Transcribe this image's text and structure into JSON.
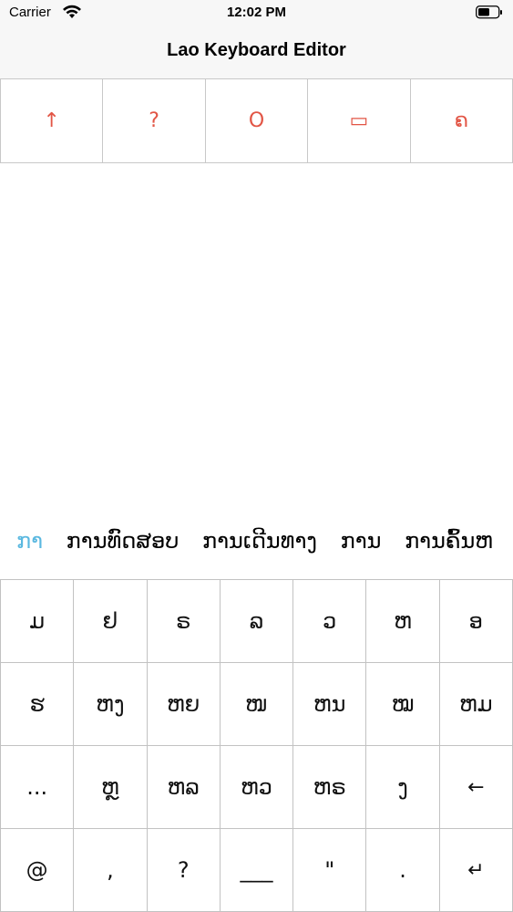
{
  "status": {
    "carrier": "Carrier",
    "time": "12:02 PM"
  },
  "nav": {
    "title": "Lao Keyboard Editor"
  },
  "toolbar": {
    "items": [
      {
        "label": "↑",
        "icon": "up-arrow-icon"
      },
      {
        "label": "?",
        "icon": "question-icon"
      },
      {
        "label": "O",
        "icon": "circle-o-icon"
      },
      {
        "label": "▭",
        "icon": "rectangle-icon"
      },
      {
        "label": "ຄ",
        "icon": "lao-letter-icon"
      }
    ],
    "accent_color": "#e25545"
  },
  "suggestions": {
    "items": [
      "ກາ",
      "ການທົດສອບ",
      "ການເດີນທາງ",
      "ການ",
      "ການຄົ້ນຫ"
    ],
    "active_index": 0,
    "active_color": "#5ab8e0"
  },
  "keyboard": {
    "rows": [
      [
        "ມ",
        "ຢ",
        "ຣ",
        "ລ",
        "ວ",
        "ຫ",
        "ອ"
      ],
      [
        "ຮ",
        "ຫງ",
        "ຫຍ",
        "ໜ",
        "ຫນ",
        "ໝ",
        "ຫມ"
      ],
      [
        "...",
        "ຫຼ",
        "ຫລ",
        "ຫວ",
        "ຫຣ",
        "ງ",
        "←"
      ],
      [
        "@",
        ",",
        "?",
        "___",
        "\"",
        ".",
        "↵"
      ]
    ]
  }
}
